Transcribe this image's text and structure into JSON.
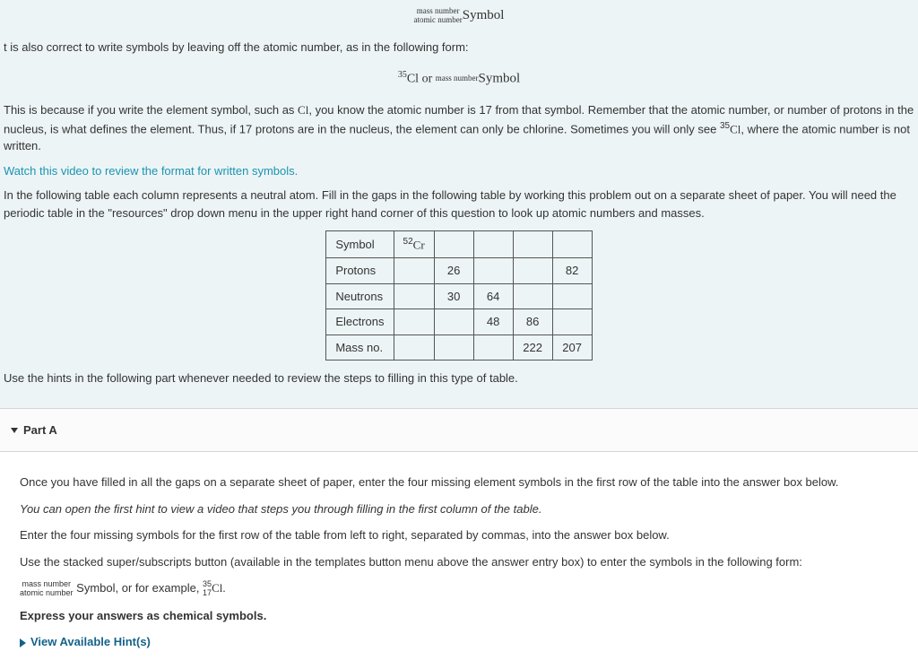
{
  "notation1": {
    "top": "mass number",
    "bot": "atomic number",
    "symbol": "Symbol"
  },
  "para1": "t is also correct to write symbols by leaving off the atomic number, as in the following form:",
  "notation2": {
    "pre_sup": "35",
    "chem": "Cl",
    "or": " or ",
    "top": "mass number",
    "symbol": "Symbol"
  },
  "para2a": "This is because if you write the element symbol, such as ",
  "para2_chem": "Cl",
  "para2b": ", you know the atomic number is 17 from that symbol. Remember that the atomic number, or number of protons in the nucleus, is what defines the element. Thus, if 17 protons are in the nucleus, the element can only be chlorine. Sometimes you will only see ",
  "para2_chem2_sup": "35",
  "para2_chem2": "Cl",
  "para2c": ", where the atomic number is not written.",
  "link_video": "Watch this video to review the format for written symbols.",
  "para3": "In the following table each column represents a neutral atom. Fill in the gaps in the following table by working this problem out on a separate sheet of paper. You will need the periodic table in the \"resources\" drop down menu in the upper right hand corner of this question to look up atomic numbers and masses.",
  "table": {
    "rows": [
      [
        "Symbol",
        "52Cr",
        "",
        "",
        "",
        "",
        ""
      ],
      [
        "Protons",
        "",
        "26",
        "",
        "",
        "82",
        ""
      ],
      [
        "Neutrons",
        "",
        "30",
        "64",
        "",
        "",
        ""
      ],
      [
        "Electrons",
        "",
        "",
        "48",
        "86",
        "",
        ""
      ],
      [
        "Mass no.",
        "",
        "",
        "",
        "222",
        "207",
        ""
      ]
    ],
    "cr_sup": "52",
    "cr_sym": "Cr"
  },
  "para4": "Use the hints in the following part whenever needed to review the steps to filling in this type of table.",
  "partA": {
    "title": "Part A",
    "p1": "Once you have filled in all the gaps on a separate sheet of paper, enter the four missing element symbols in the first row of the table into the answer box below.",
    "p2": "You can open the first hint to view a video that steps you through filling in the first column of the table.",
    "p3": "Enter the four missing symbols for the first row of the table from left to right, separated by commas, into the answer box below.",
    "p4": "Use the stacked super/subscripts button (available in the templates button menu above the answer entry box) to enter the symbols in the following form:",
    "notation": {
      "top": "mass number",
      "bot": "atomic number",
      "mid": "Symbol, or for example, ",
      "ex_sup": "35",
      "ex_sub": "17",
      "ex_sym": "Cl."
    },
    "p5": "Express your answers as chemical symbols.",
    "hints": "View Available Hint(s)"
  }
}
